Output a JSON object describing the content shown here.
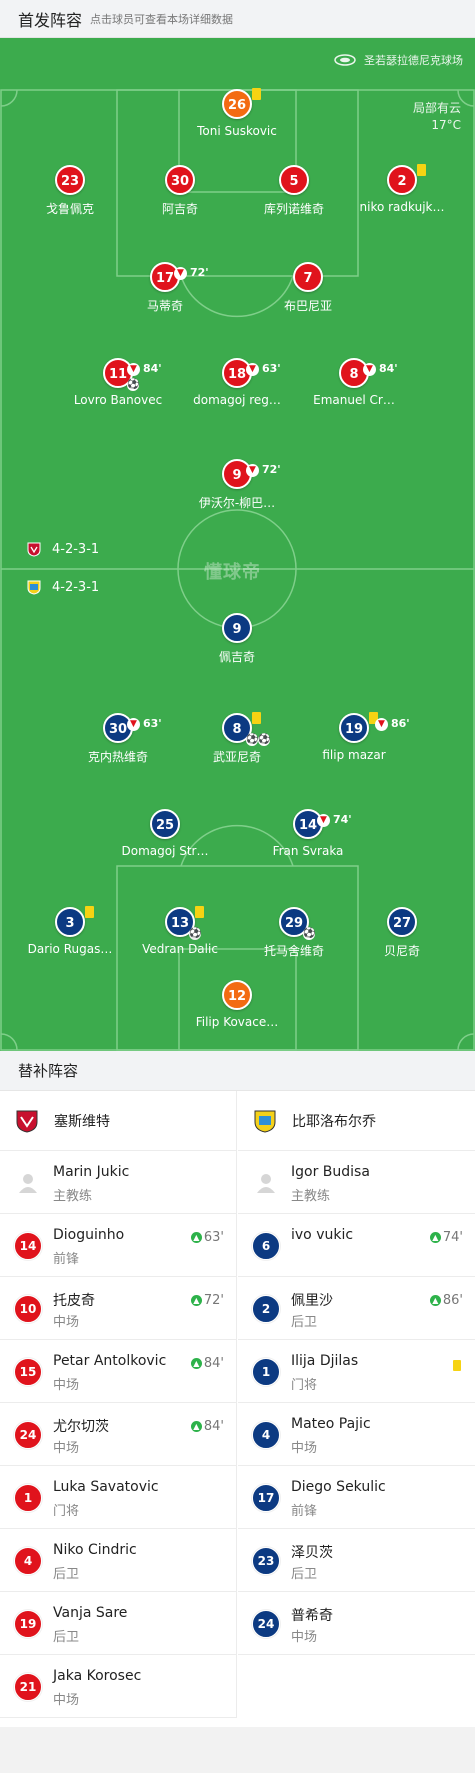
{
  "header": {
    "title": "首发阵容",
    "subtitle": "点击球员可查看本场详细数据"
  },
  "pitch": {
    "stadium": "圣若瑟拉德尼克球场",
    "weather": "局部有云",
    "temperature": "17°C",
    "watermark": "懂球帝",
    "home_formation": "4-2-3-1",
    "away_formation": "4-2-3-1",
    "colors": {
      "home": "#e0131c",
      "away": "#0c3a82",
      "keeper": "#f36b12",
      "grass": "#3cab4d"
    }
  },
  "home": [
    {
      "num": "26",
      "name": "Toni Suskovic",
      "keeper": true,
      "card": true
    },
    {
      "num": "23",
      "name": "戈鲁佩克"
    },
    {
      "num": "30",
      "name": "阿吉奇"
    },
    {
      "num": "5",
      "name": "库列诺维奇"
    },
    {
      "num": "2",
      "name": "niko radkuјk…",
      "card": true
    },
    {
      "num": "17",
      "name": "马蒂奇",
      "off": "72'"
    },
    {
      "num": "7",
      "name": "布巴尼亚"
    },
    {
      "num": "11",
      "name": "Lovro Banovec",
      "off": "84'",
      "goals": 1
    },
    {
      "num": "18",
      "name": "domagoj reg…",
      "off": "63'"
    },
    {
      "num": "8",
      "name": "Emanuel Cr…",
      "off": "84'"
    },
    {
      "num": "9",
      "name": "伊沃尔-柳巴…",
      "off": "72'"
    }
  ],
  "away": [
    {
      "num": "9",
      "name": "佩吉奇"
    },
    {
      "num": "30",
      "name": "克内热维奇",
      "off": "63'"
    },
    {
      "num": "8",
      "name": "武亚尼奇",
      "card": true,
      "goals": 2
    },
    {
      "num": "19",
      "name": "filip mazar",
      "card": true,
      "off": "86'"
    },
    {
      "num": "25",
      "name": "Domagoj Str…"
    },
    {
      "num": "14",
      "name": "Fran Svraka",
      "off": "74'"
    },
    {
      "num": "3",
      "name": "Dario Rugas…",
      "card": true
    },
    {
      "num": "13",
      "name": "Vedran Dalic",
      "card": true,
      "owngoal": true
    },
    {
      "num": "29",
      "name": "托马舍维奇",
      "goals": 1
    },
    {
      "num": "27",
      "name": "贝尼奇"
    },
    {
      "num": "12",
      "name": "Filip Kovace…",
      "keeper": true
    }
  ],
  "subs": {
    "title": "替补阵容",
    "home_team": "塞斯维特",
    "away_team": "比耶洛布尔乔",
    "home": [
      {
        "name": "Marin Jukic",
        "pos": "主教练",
        "coach": true
      },
      {
        "num": "14",
        "name": "Dioguinho",
        "pos": "前锋",
        "on": "63'"
      },
      {
        "num": "10",
        "name": "托皮奇",
        "pos": "中场",
        "on": "72'"
      },
      {
        "num": "15",
        "name": "Petar Antolkovic",
        "pos": "中场",
        "on": "84'"
      },
      {
        "num": "24",
        "name": "尤尔切茨",
        "pos": "中场",
        "on": "84'"
      },
      {
        "num": "1",
        "name": "Luka Savatovic",
        "pos": "门将"
      },
      {
        "num": "4",
        "name": "Niko Cindric",
        "pos": "后卫"
      },
      {
        "num": "19",
        "name": "Vanja Sare",
        "pos": "后卫"
      },
      {
        "num": "21",
        "name": "Jaka Korosec",
        "pos": "中场"
      }
    ],
    "away": [
      {
        "name": "Igor Budisa",
        "pos": "主教练",
        "coach": true
      },
      {
        "num": "6",
        "name": "ivo vukic",
        "pos": "",
        "on": "74'"
      },
      {
        "num": "2",
        "name": "佩里沙",
        "pos": "后卫",
        "on": "86'"
      },
      {
        "num": "1",
        "name": "Ilija Djilas",
        "pos": "门将",
        "card": true
      },
      {
        "num": "4",
        "name": "Mateo Pajic",
        "pos": "中场"
      },
      {
        "num": "17",
        "name": "Diego Sekulic",
        "pos": "前锋"
      },
      {
        "num": "23",
        "name": "泽贝茨",
        "pos": "后卫"
      },
      {
        "num": "24",
        "name": "普希奇",
        "pos": "中场"
      }
    ]
  }
}
